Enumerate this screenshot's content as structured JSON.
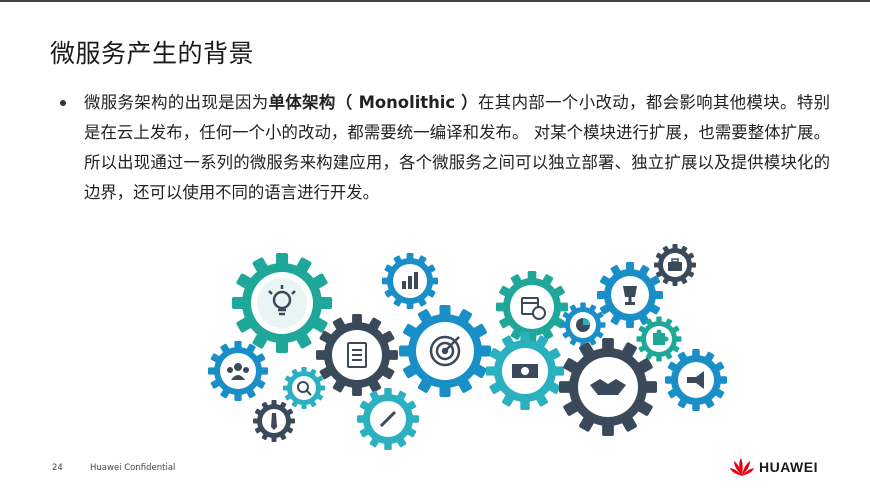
{
  "slide": {
    "title": "微服务产生的背景",
    "bullet": {
      "p1": "微服务架构的出现是因为",
      "bold": "单体架构（ Monolithic ）",
      "p2": "在其内部一个小改动，都会影响其他模块。特别是在云上发布，任何一个小的改动，都需要统一编译和发布。 对某个模块进行扩展，也需要整体扩展。所以出现通过一系列的微服务来构建应用，各个微服务之间可以独立部署、独立扩展以及提供模块化的边界，还可以使用不同的语言进行开发。"
    },
    "illustration": {
      "icons": [
        "lightbulb-icon",
        "bar-chart-icon",
        "calendar-clock-icon",
        "trophy-icon",
        "briefcase-icon",
        "team-icon",
        "search-icon",
        "checklist-icon",
        "target-icon",
        "money-icon",
        "puzzle-icon",
        "pie-chart-icon",
        "handshake-icon",
        "megaphone-icon",
        "pen-icon",
        "tie-icon"
      ],
      "colors": {
        "dark": "#3b4a5a",
        "teal": "#2bb0c0",
        "green": "#1fa89a",
        "blue": "#1a8fc7"
      }
    }
  },
  "footer": {
    "page_number": "24",
    "confidential": "Huawei Confidential",
    "brand": "HUAWEI",
    "brand_color": "#e60012"
  }
}
